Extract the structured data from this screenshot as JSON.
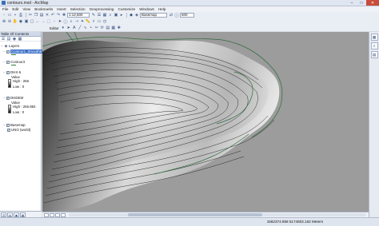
{
  "window": {
    "title": "contours.mxd - ArcMap",
    "controls": [
      "–",
      "□",
      "✕"
    ]
  },
  "menu": [
    "File",
    "Edit",
    "View",
    "Bookmarks",
    "Insert",
    "Selection",
    "Geoprocessing",
    "Customize",
    "Windows",
    "Help"
  ],
  "toolbar": {
    "scale": "1:12,500",
    "basemap_label": "Basemap",
    "zoom_value": "500",
    "editor_label": "Editor"
  },
  "toc": {
    "title": "Table Of Contents",
    "layers_label": "Layers",
    "layers": [
      {
        "name": "Contour1_Smooth6",
        "selected": true
      },
      {
        "name": "Contour3",
        "selected": false
      },
      {
        "name": "DHX-5",
        "value_label": "Value",
        "high": "High : 256",
        "low": "Low : 0"
      },
      {
        "name": "DHDEM",
        "value_label": "Value",
        "high": "High : 256.884",
        "low": "Low : 0"
      },
      {
        "name": "Basemap",
        "sublayer": "UNO (world)"
      }
    ]
  },
  "status": {
    "coordinates": "1582374.958 5174503.162 Meters"
  },
  "colors": {
    "contour": "#2e6b3e",
    "map_background": "#9c9c9c"
  }
}
